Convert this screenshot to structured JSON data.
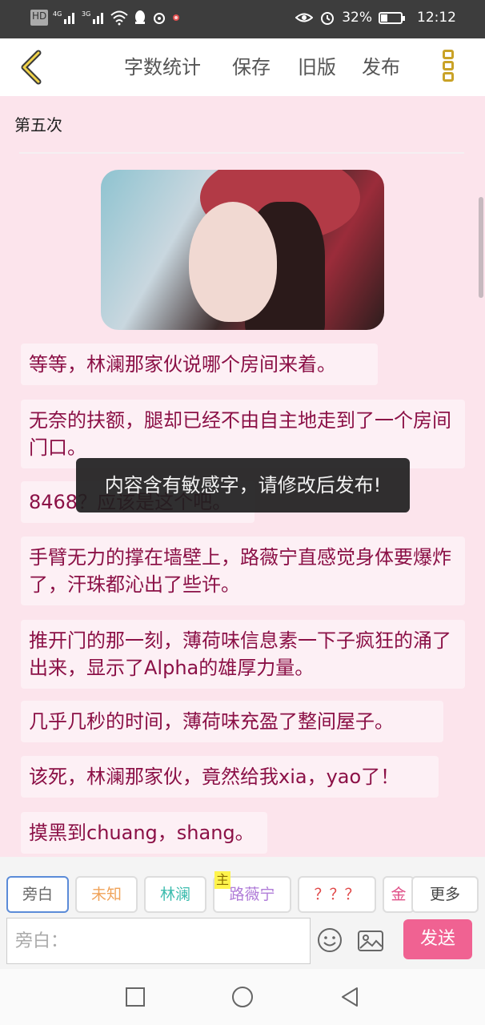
{
  "status_bar": {
    "left_icons": [
      "HD",
      "4G",
      "3G",
      "wifi-icon",
      "notification-icon",
      "weibo-icon",
      "dot-icon"
    ],
    "hd": "HD",
    "net1": "4G",
    "net2": "3G",
    "battery_percent": "32%",
    "battery_level": 0.32,
    "time": "12:12"
  },
  "toolbar": {
    "word_count": "字数统计",
    "save": "保存",
    "old_version": "旧版",
    "publish": "发布"
  },
  "chapter_title": "第五次",
  "messages": [
    "等等，林澜那家伙说哪个房间来着。",
    "无奈的扶额，腿却已经不由自主地走到了一个房间门口。",
    "8468？应该是这个吧。",
    "手臂无力的撑在墙壁上，路薇宁直感觉身体要爆炸了，汗珠都沁出了些许。",
    "推开门的那一刻，薄荷味信息素一下子疯狂的涌了出来，显示了Alpha的雄厚力量。",
    "几乎几秒的时间，薄荷味充盈了整间屋子。",
    "该死，林澜那家伙，竟然给我xia，yao了！",
    "摸黑到chuang，shang。"
  ],
  "toast": "内容含有敏感字，请修改后发布!",
  "characters": [
    {
      "label": "旁白",
      "color": "#666666"
    },
    {
      "label": "未知",
      "color": "#f0a35a"
    },
    {
      "label": "林澜",
      "color": "#3cbcae"
    },
    {
      "label": "路薇宁",
      "color": "#b07cd8",
      "badge": "主"
    },
    {
      "label": "？？？",
      "color": "#e04848"
    },
    {
      "label": "金",
      "color": "#e05088"
    }
  ],
  "more": "更多",
  "input": {
    "placeholder": "旁白："
  },
  "send": "发送"
}
